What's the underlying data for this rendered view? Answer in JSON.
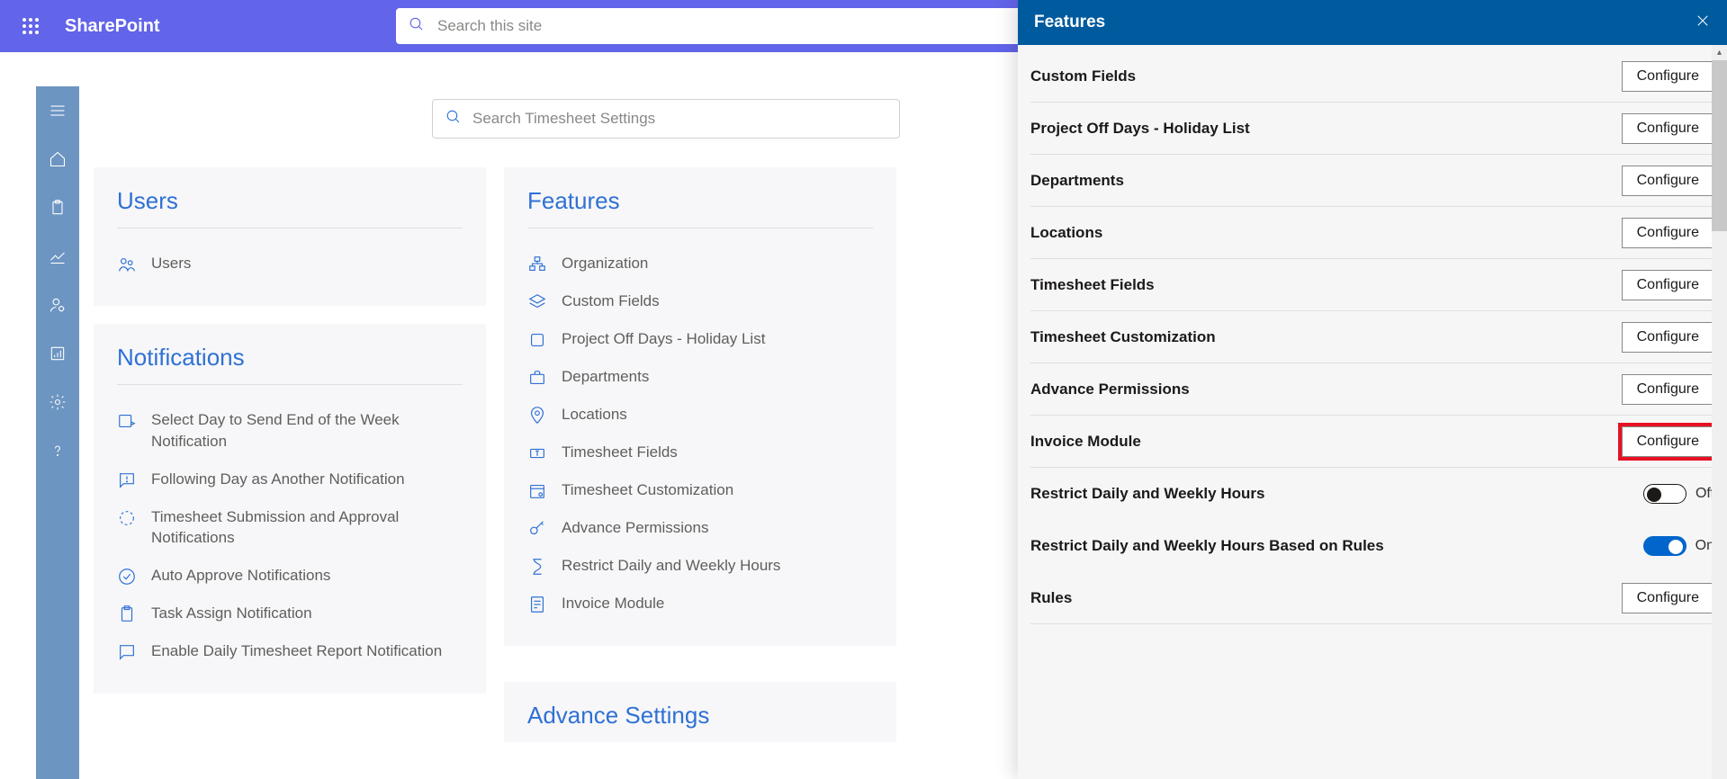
{
  "header": {
    "brand": "SharePoint",
    "search_placeholder": "Search this site"
  },
  "settings_search_placeholder": "Search Timesheet Settings",
  "cards": {
    "users": {
      "title": "Users",
      "items": [
        "Users"
      ]
    },
    "notifications": {
      "title": "Notifications",
      "items": [
        "Select Day to Send End of the Week Notification",
        "Following Day as Another Notification",
        "Timesheet Submission and Approval Notifications",
        "Auto Approve Notifications",
        "Task Assign Notification",
        "Enable Daily Timesheet Report Notification"
      ]
    },
    "features": {
      "title": "Features",
      "items": [
        "Organization",
        "Custom Fields",
        "Project Off Days - Holiday List",
        "Departments",
        "Locations",
        "Timesheet Fields",
        "Timesheet Customization",
        "Advance Permissions",
        "Restrict Daily and Weekly Hours",
        "Invoice Module"
      ]
    },
    "advance": {
      "title": "Advance Settings"
    }
  },
  "panel": {
    "title": "Features",
    "configure_label": "Configure",
    "off_label": "Off",
    "on_label": "On",
    "rows": [
      {
        "label": "Custom Fields",
        "type": "configure"
      },
      {
        "label": "Project Off Days - Holiday List",
        "type": "configure"
      },
      {
        "label": "Departments",
        "type": "configure"
      },
      {
        "label": "Locations",
        "type": "configure"
      },
      {
        "label": "Timesheet Fields",
        "type": "configure"
      },
      {
        "label": "Timesheet Customization",
        "type": "configure"
      },
      {
        "label": "Advance Permissions",
        "type": "configure"
      },
      {
        "label": "Invoice Module",
        "type": "configure",
        "highlight": true
      },
      {
        "label": "Restrict Daily and Weekly Hours",
        "type": "toggle",
        "state": "Off"
      },
      {
        "label": "Restrict Daily and Weekly Hours Based on Rules",
        "type": "toggle",
        "state": "On"
      },
      {
        "label": "Rules",
        "type": "configure"
      }
    ]
  }
}
